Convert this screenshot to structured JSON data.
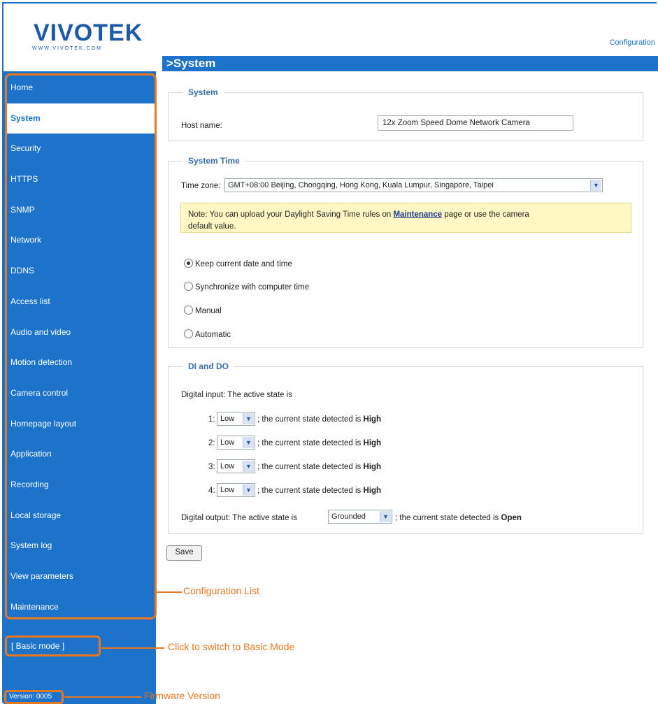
{
  "header": {
    "logo_text": "VIVOTEK",
    "logo_url": "WWW.VIVOTEK.COM",
    "config_link": "Configuration",
    "page_title": ">System"
  },
  "sidebar": {
    "items": [
      {
        "label": "Home",
        "active": false
      },
      {
        "label": "System",
        "active": true
      },
      {
        "label": "Security",
        "active": false
      },
      {
        "label": "HTTPS",
        "active": false
      },
      {
        "label": "SNMP",
        "active": false
      },
      {
        "label": "Network",
        "active": false
      },
      {
        "label": "DDNS",
        "active": false
      },
      {
        "label": "Access list",
        "active": false
      },
      {
        "label": "Audio and video",
        "active": false
      },
      {
        "label": "Motion detection",
        "active": false
      },
      {
        "label": "Camera control",
        "active": false
      },
      {
        "label": "Homepage layout",
        "active": false
      },
      {
        "label": "Application",
        "active": false
      },
      {
        "label": "Recording",
        "active": false
      },
      {
        "label": "Local storage",
        "active": false
      },
      {
        "label": "System log",
        "active": false
      },
      {
        "label": "View parameters",
        "active": false
      },
      {
        "label": "Maintenance",
        "active": false
      }
    ],
    "basic_mode": "[ Basic mode ]",
    "version": "Version: 0005"
  },
  "callouts": {
    "config_list": "Configuration List",
    "basic_mode": "Click to switch to Basic Mode",
    "firmware": "Firmware Version"
  },
  "system": {
    "legend": "System",
    "host_label": "Host name:",
    "host_value": "12x Zoom Speed Dome Network Camera"
  },
  "system_time": {
    "legend": "System Time",
    "tz_label": "Time zone:",
    "tz_value": "GMT+08:00 Beijing, Chongqing, Hong Kong, Kuala Lumpur, Singapore, Taipei",
    "note_pre": "Note: You can upload your Daylight Saving Time rules on",
    "note_link": "Maintenance",
    "note_post": "page or use the camera",
    "note_line2": "default value.",
    "options": [
      {
        "label": "Keep current date and time",
        "selected": true
      },
      {
        "label": "Synchronize with computer time",
        "selected": false
      },
      {
        "label": "Manual",
        "selected": false
      },
      {
        "label": "Automatic",
        "selected": false
      }
    ]
  },
  "dido": {
    "legend": "DI and DO",
    "di_label": "Digital input: The active state is",
    "inputs": [
      {
        "num": "1:",
        "value": "Low",
        "text": "; the current state detected is",
        "state": "High"
      },
      {
        "num": "2:",
        "value": "Low",
        "text": "; the current state detected is",
        "state": "High"
      },
      {
        "num": "3:",
        "value": "Low",
        "text": "; the current state detected is",
        "state": "High"
      },
      {
        "num": "4:",
        "value": "Low",
        "text": "; the current state detected is",
        "state": "High"
      }
    ],
    "do_label": "Digital output: The active state is",
    "do_value": "Grounded",
    "do_text": "; the current state detected is",
    "do_state": "Open"
  },
  "save_label": "Save",
  "colors": {
    "accent": "#1c73c9",
    "callout": "#e87722",
    "note_bg": "#fff8c4"
  }
}
